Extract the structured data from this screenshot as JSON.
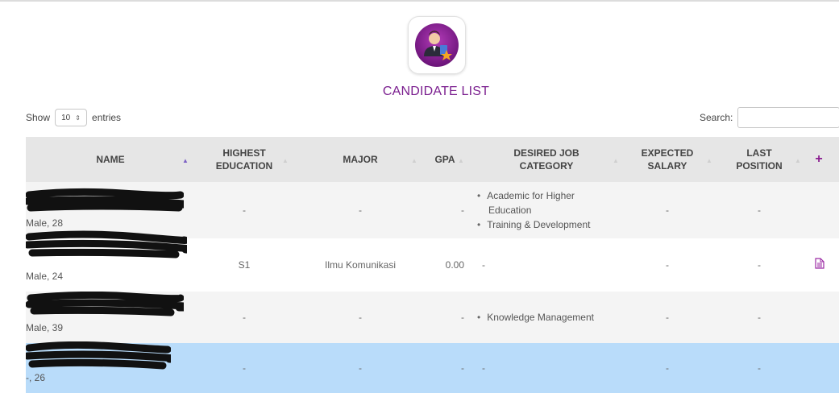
{
  "header": {
    "title": "CANDIDATE LIST"
  },
  "controls": {
    "show_label": "Show",
    "entries_value": "10",
    "entries_label": "entries",
    "search_label": "Search:"
  },
  "columns": [
    {
      "label": "NAME"
    },
    {
      "label": "HIGHEST",
      "label2": "EDUCATION"
    },
    {
      "label": "MAJOR"
    },
    {
      "label": "GPA"
    },
    {
      "label": "DESIRED JOB",
      "label2": "CATEGORY"
    },
    {
      "label": "EXPECTED",
      "label2": "SALARY"
    },
    {
      "label": "LAST",
      "label2": "POSITION"
    },
    {
      "label": "+"
    }
  ],
  "rows": [
    {
      "meta": "Male, 28",
      "education": "-",
      "major": "-",
      "gpa": "-",
      "jobs": [
        "Academic for Higher",
        "Education",
        "Training & Development"
      ],
      "salary": "-",
      "position": "-"
    },
    {
      "meta": "Male, 24",
      "education": "S1",
      "major": "Ilmu Komunikasi",
      "gpa": "0.00",
      "job_text": "-",
      "salary": "-",
      "position": "-",
      "has_doc": true
    },
    {
      "meta": "Male, 39",
      "education": "-",
      "major": "-",
      "gpa": "-",
      "jobs": [
        "Knowledge Management"
      ],
      "salary": "-",
      "position": "-"
    },
    {
      "meta": "-, 26",
      "education": "-",
      "major": "-",
      "gpa": "-",
      "job_text": "-",
      "salary": "-",
      "position": "-"
    }
  ],
  "colors": {
    "accent": "#7b1f8f",
    "header_bg": "#e6e6e6",
    "selected_row": "#b9dcfa"
  },
  "icons": {
    "logo": "candidate-logo-icon",
    "document": "document-icon",
    "sort": "sort-arrow-icon"
  }
}
